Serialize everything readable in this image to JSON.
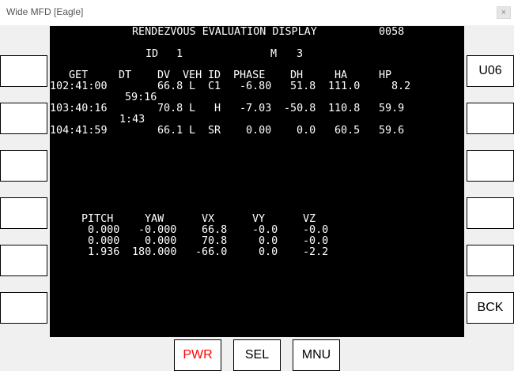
{
  "window": {
    "title": "Wide MFD [Eagle]",
    "close_glyph": "×"
  },
  "display": {
    "title": "RENDEZVOUS EVALUATION DISPLAY",
    "page_number": "0058",
    "id_label": "ID",
    "id_value": "1",
    "m_label": "M",
    "m_value": "3",
    "table": {
      "headers": [
        "GET",
        "DT",
        "DV",
        "VEH",
        "ID",
        "PHASE",
        "DH",
        "HA",
        "HP"
      ],
      "rows": [
        {
          "get": "102:41:00",
          "dv": "66.8",
          "veh": "L",
          "id": "C1",
          "phase": "-6.80",
          "dh": "51.8",
          "ha": "111.0",
          "hp": "8.2"
        },
        {
          "get": "103:40:16",
          "dv": "70.8",
          "veh": "L",
          "id": "H",
          "phase": "-7.03",
          "dh": "-50.8",
          "ha": "110.8",
          "hp": "59.9"
        },
        {
          "get": "104:41:59",
          "dv": "66.1",
          "veh": "L",
          "id": "SR",
          "phase": "0.00",
          "dh": "0.0",
          "ha": "60.5",
          "hp": "59.6"
        }
      ],
      "dts": [
        "59:16",
        "1:43"
      ]
    },
    "attitude": {
      "headers": [
        "PITCH",
        "YAW",
        "VX",
        "VY",
        "VZ"
      ],
      "rows": [
        {
          "pitch": "0.000",
          "yaw": "-0.000",
          "vx": "66.8",
          "vy": "-0.0",
          "vz": "-0.0"
        },
        {
          "pitch": "0.000",
          "yaw": "0.000",
          "vx": "70.8",
          "vy": "0.0",
          "vz": "-0.0"
        },
        {
          "pitch": "1.936",
          "yaw": "180.000",
          "vx": "-66.0",
          "vy": "0.0",
          "vz": "-2.2"
        }
      ]
    }
  },
  "left_buttons": [
    "",
    "",
    "",
    "",
    "",
    ""
  ],
  "right_buttons": [
    "U06",
    "",
    "",
    "",
    "",
    "BCK"
  ],
  "bottom_buttons": {
    "pwr": "PWR",
    "sel": "SEL",
    "mnu": "MNU"
  },
  "colors": {
    "screen_bg": "#000000",
    "text": "#ffffff",
    "pwr_label": "#ff0000",
    "frame_bg": "#f0f0f0"
  }
}
